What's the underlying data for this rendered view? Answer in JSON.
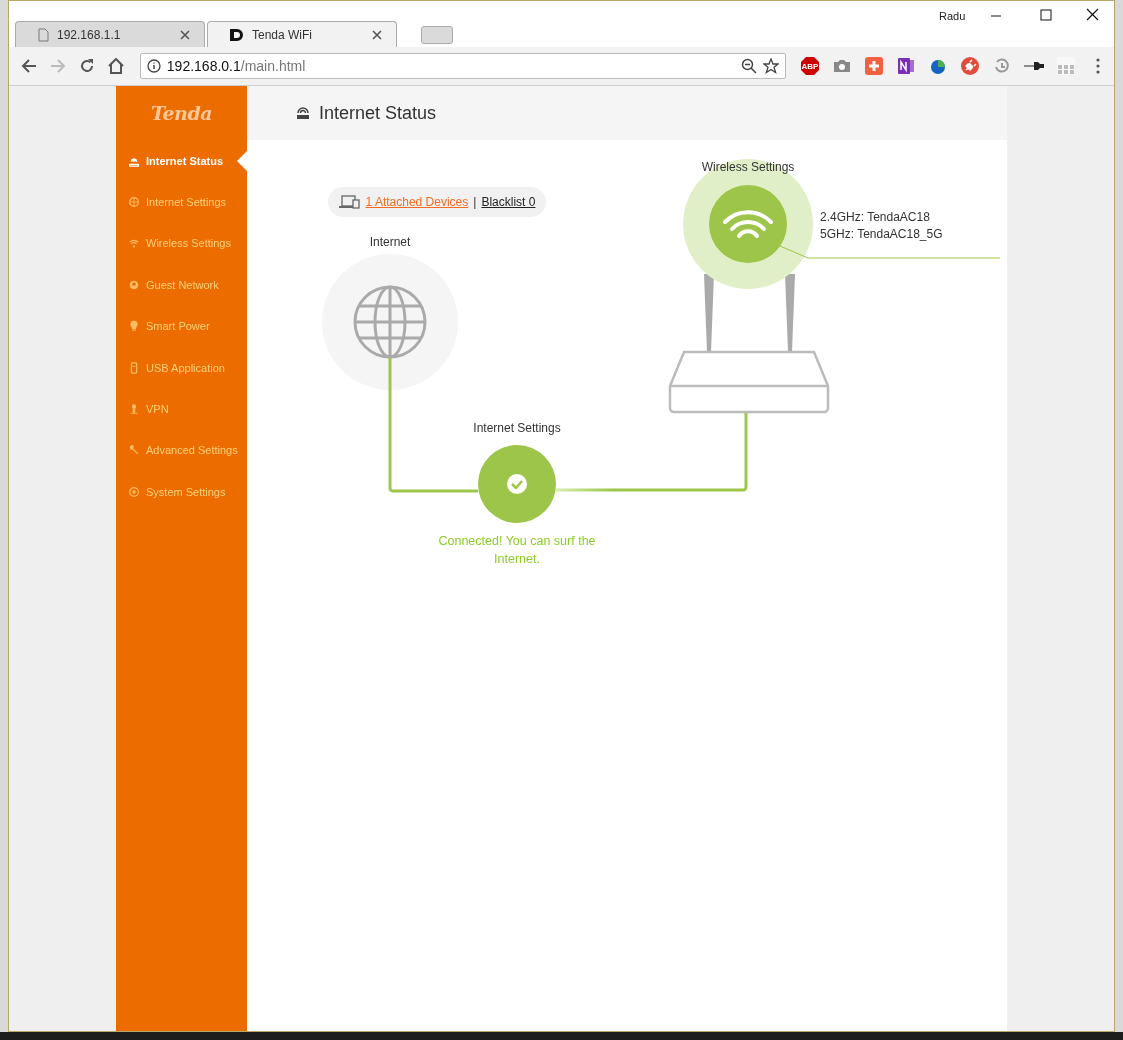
{
  "browser": {
    "tabs": [
      {
        "title": "192.168.1.1",
        "selected": false
      },
      {
        "title": "Tenda WiFi",
        "selected": true
      }
    ],
    "profile": "Radu",
    "address": {
      "host": "192.168.0.1",
      "path": "/main.html"
    },
    "extension_badge": "ABP"
  },
  "sidebar": {
    "logo": "Tenda",
    "items": [
      {
        "label": "Internet Status",
        "selected": true
      },
      {
        "label": "Internet Settings",
        "selected": false
      },
      {
        "label": "Wireless Settings",
        "selected": false
      },
      {
        "label": "Guest Network",
        "selected": false
      },
      {
        "label": "Smart Power",
        "selected": false
      },
      {
        "label": "USB Application",
        "selected": false
      },
      {
        "label": "VPN",
        "selected": false
      },
      {
        "label": "Advanced Settings",
        "selected": false
      },
      {
        "label": "System Settings",
        "selected": false
      }
    ]
  },
  "page": {
    "title": "Internet Status",
    "devices": {
      "attached": "1 Attached Devices ",
      "separator": "|",
      "blacklist": "Blacklist 0"
    },
    "internet": {
      "label": "Internet"
    },
    "wan": {
      "label": "Internet Settings",
      "connected": true,
      "message": "Connected! You can surf the Internet."
    },
    "wireless": {
      "label": "Wireless Settings",
      "ssids": [
        "2.4GHz: TendaAC18",
        "5GHz: TendaAC18_5G"
      ]
    }
  }
}
